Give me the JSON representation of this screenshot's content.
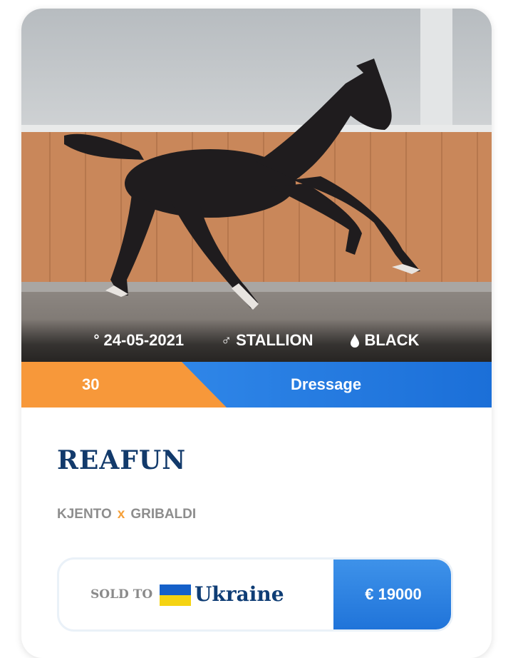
{
  "horse": {
    "photo_icon": "horse-photo",
    "birth_date": "24-05-2021",
    "birth_icon": "degree-icon",
    "sex": "STALLION",
    "sex_icon": "male-symbol-icon",
    "color": "BLACK",
    "color_icon": "drop-icon",
    "lot_number": "30",
    "discipline": "Dressage",
    "name": "REAFUN",
    "sire": "KJENTO",
    "cross": "x",
    "dam_sire": "GRIBALDI"
  },
  "sale": {
    "sold_to_label": "SOLD TO",
    "country": "Ukraine",
    "flag_icon": "ukraine-flag-icon",
    "price": "€ 19000"
  },
  "colors": {
    "accent_orange": "#f7983a",
    "accent_blue": "#2f86e8",
    "title_navy": "#123a6b"
  }
}
